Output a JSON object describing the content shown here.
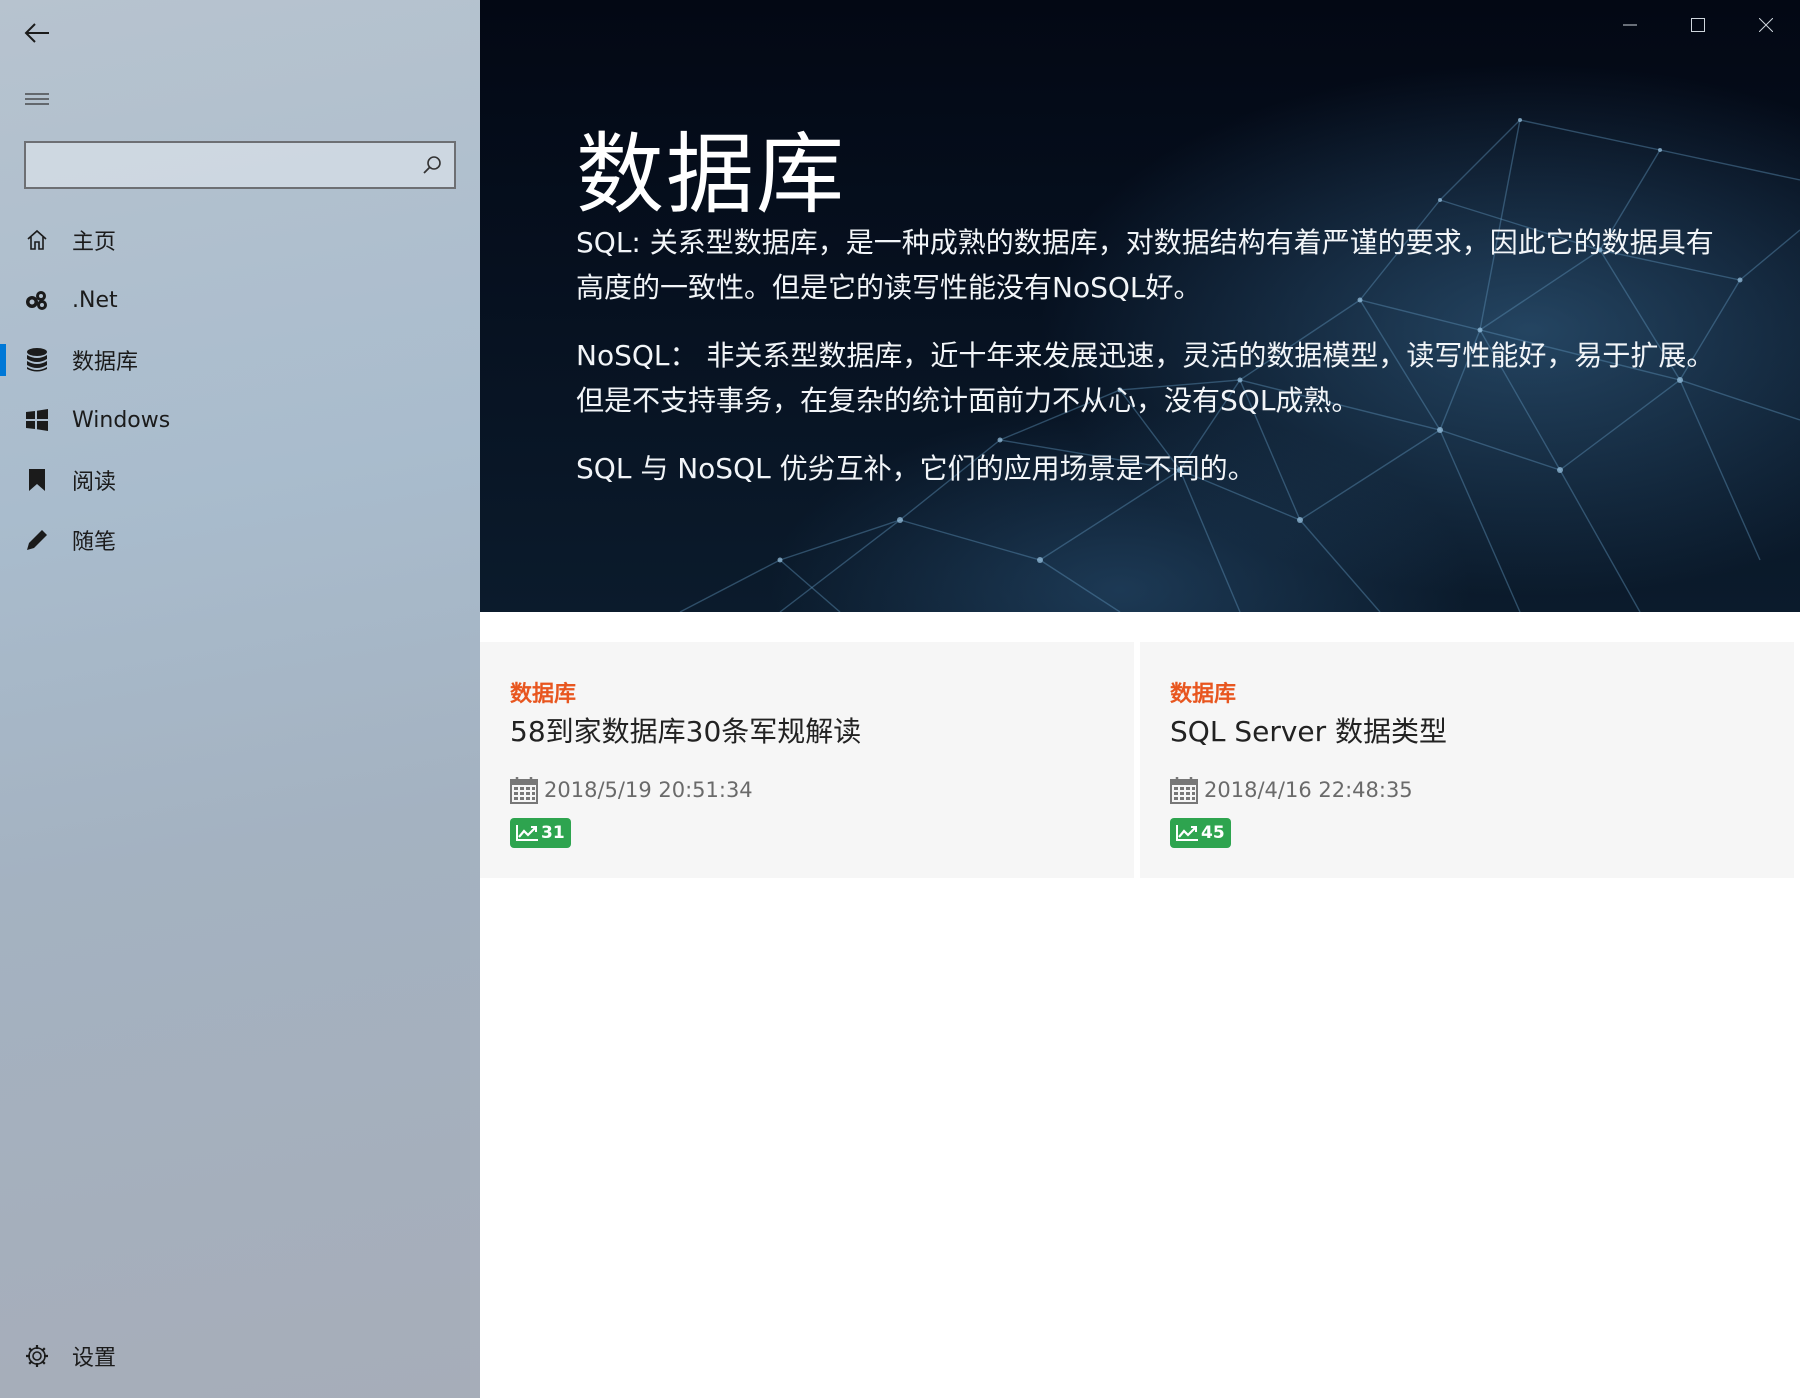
{
  "sidebar": {
    "search": {
      "value": "",
      "placeholder": ""
    },
    "items": [
      {
        "label": "主页",
        "icon": "home-icon"
      },
      {
        "label": ".Net",
        "icon": "dotnet-icon"
      },
      {
        "label": "数据库",
        "icon": "database-icon",
        "active": true
      },
      {
        "label": "Windows",
        "icon": "windows-icon"
      },
      {
        "label": "阅读",
        "icon": "bookmark-icon"
      },
      {
        "label": "随笔",
        "icon": "pencil-icon"
      }
    ],
    "settings_label": "设置"
  },
  "hero": {
    "title": "数据库",
    "paragraphs": [
      "SQL: 关系型数据库，是一种成熟的数据库，对数据结构有着严谨的要求，因此它的数据具有高度的一致性。但是它的读写性能没有NoSQL好。",
      "NoSQL： 非关系型数据库，近十年来发展迅速，灵活的数据模型，读写性能好，易于扩展。但是不支持事务，在复杂的统计面前力不从心，没有SQL成熟。",
      "SQL 与 NoSQL 优劣互补，它们的应用场景是不同的。"
    ]
  },
  "cards": [
    {
      "category": "数据库",
      "title": "58到家数据库30条军规解读",
      "date": "2018/5/19 20:51:34",
      "views": "31"
    },
    {
      "category": "数据库",
      "title": "SQL Server 数据类型",
      "date": "2018/4/16 22:48:35",
      "views": "45"
    }
  ],
  "colors": {
    "accent": "#0078d7",
    "category": "#e8561f",
    "badge": "#2ea44f"
  }
}
